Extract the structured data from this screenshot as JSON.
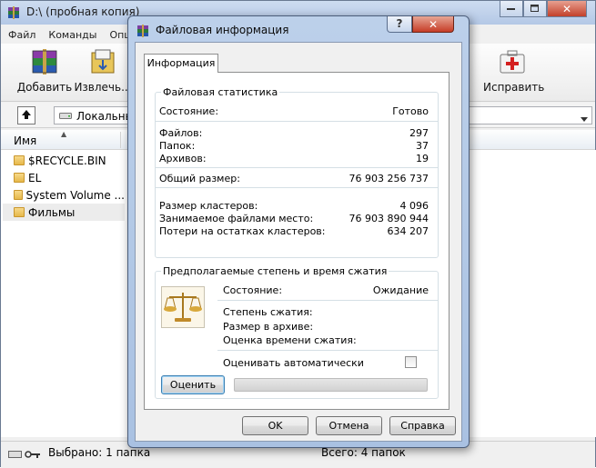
{
  "main": {
    "title": "D:\\ (пробная копия)",
    "menu": [
      "Файл",
      "Команды",
      "Опц"
    ],
    "toolbar": {
      "add_label": "Добавить",
      "extract_label": "Извлечь...",
      "repair_label": "Исправить"
    },
    "address": "Локальны",
    "column_name": "Имя",
    "files": [
      {
        "name": "$RECYCLE.BIN"
      },
      {
        "name": "EL"
      },
      {
        "name": "System Volume ..."
      },
      {
        "name": "Фильмы"
      }
    ],
    "status_selected": "Выбрано: 1 папка",
    "status_total": "Всего: 4 папок"
  },
  "dialog": {
    "title": "Файловая информация",
    "help_glyph": "?",
    "tab_label": "Информация",
    "file_stats": {
      "group_title": "Файловая статистика",
      "state_label": "Состояние:",
      "state_value": "Готово",
      "files_label": "Файлов:",
      "files_value": "297",
      "folders_label": "Папок:",
      "folders_value": "37",
      "archives_label": "Архивов:",
      "archives_value": "19",
      "total_size_label": "Общий размер:",
      "total_size_value": "76 903 256 737",
      "cluster_size_label": "Размер кластеров:",
      "cluster_size_value": "4 096",
      "occupied_label": "Занимаемое файлами место:",
      "occupied_value": "76 903 890 944",
      "loss_label": "Потери на остатках кластеров:",
      "loss_value": "634 207"
    },
    "compression": {
      "group_title": "Предполагаемые степень и время сжатия",
      "state_label": "Состояние:",
      "state_value": "Ожидание",
      "ratio_label": "Степень сжатия:",
      "size_label": "Размер в архиве:",
      "time_label": "Оценка времени сжатия:",
      "auto_label": "Оценивать автоматически",
      "auto_checked": false,
      "estimate_button": "Оценить",
      "progress": 0
    },
    "buttons": {
      "ok": "OK",
      "cancel": "Отмена",
      "help": "Справка"
    }
  },
  "colors": {
    "title_gradient_top": "#bcd0ea",
    "close_red": "#c63c26",
    "panel_border": "#d5dfe5"
  }
}
